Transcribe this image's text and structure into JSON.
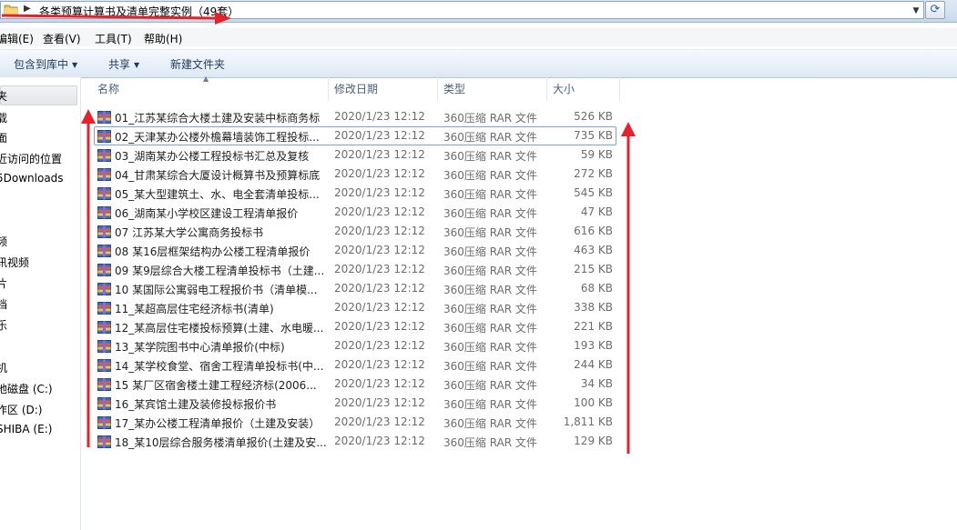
{
  "address": {
    "path": "各类预算计算书及清单完整实例（49套）"
  },
  "menu": [
    "编辑(E)",
    "查看(V)",
    "工具(T)",
    "帮助(H)"
  ],
  "toolbar": {
    "include_library": "包含到库中",
    "share": "共享",
    "new_folder": "新建文件夹"
  },
  "nav": [
    "夹",
    "载",
    "面",
    "近访问的位置",
    "5Downloads",
    "频",
    "讯视频",
    "片",
    "档",
    "乐",
    "机",
    "地磁盘 (C:)",
    "作区 (D:)",
    "SHIBA (E:)"
  ],
  "columns": {
    "name": "名称",
    "date": "修改日期",
    "type": "类型",
    "size": "大小"
  },
  "files": [
    {
      "name": "01_江苏某综合大楼土建及安装中标商务标",
      "date": "2020/1/23 12:12",
      "type": "360压缩 RAR 文件",
      "size": "526 KB"
    },
    {
      "name": "02_天津某办公楼外檐幕墙装饰工程投标...",
      "date": "2020/1/23 12:12",
      "type": "360压缩 RAR 文件",
      "size": "735 KB"
    },
    {
      "name": "03_湖南某办公楼工程投标书汇总及复核",
      "date": "2020/1/23 12:12",
      "type": "360压缩 RAR 文件",
      "size": "59 KB"
    },
    {
      "name": "04_甘肃某综合大厦设计概算书及预算标底",
      "date": "2020/1/23 12:12",
      "type": "360压缩 RAR 文件",
      "size": "272 KB"
    },
    {
      "name": "05_某大型建筑土、水、电全套清单投标...",
      "date": "2020/1/23 12:12",
      "type": "360压缩 RAR 文件",
      "size": "545 KB"
    },
    {
      "name": "06_湖南某小学校区建设工程清单报价",
      "date": "2020/1/23 12:12",
      "type": "360压缩 RAR 文件",
      "size": "47 KB"
    },
    {
      "name": "07 江苏某大学公寓商务投标书",
      "date": "2020/1/23 12:12",
      "type": "360压缩 RAR 文件",
      "size": "616 KB"
    },
    {
      "name": "08 某16层框架结构办公楼工程清单报价",
      "date": "2020/1/23 12:12",
      "type": "360压缩 RAR 文件",
      "size": "463 KB"
    },
    {
      "name": "09 某9层综合大楼工程清单投标书（土建...",
      "date": "2020/1/23 12:12",
      "type": "360压缩 RAR 文件",
      "size": "215 KB"
    },
    {
      "name": "10 某国际公寓弱电工程报价书（清单模...",
      "date": "2020/1/23 12:12",
      "type": "360压缩 RAR 文件",
      "size": "68 KB"
    },
    {
      "name": "11_某超高层住宅经济标书(清单)",
      "date": "2020/1/23 12:12",
      "type": "360压缩 RAR 文件",
      "size": "338 KB"
    },
    {
      "name": "12_某高层住宅楼投标预算(土建、水电暖...",
      "date": "2020/1/23 12:12",
      "type": "360压缩 RAR 文件",
      "size": "221 KB"
    },
    {
      "name": "13_某学院图书中心清单报价(中标)",
      "date": "2020/1/23 12:12",
      "type": "360压缩 RAR 文件",
      "size": "193 KB"
    },
    {
      "name": "14_某学校食堂、宿舍工程清单投标书(中...",
      "date": "2020/1/23 12:12",
      "type": "360压缩 RAR 文件",
      "size": "244 KB"
    },
    {
      "name": "15 某厂区宿舍楼土建工程经济标(2006...",
      "date": "2020/1/23 12:12",
      "type": "360压缩 RAR 文件",
      "size": "34 KB"
    },
    {
      "name": "16_某宾馆土建及装修投标报价书",
      "date": "2020/1/23 12:12",
      "type": "360压缩 RAR 文件",
      "size": "100 KB"
    },
    {
      "name": "17_某办公楼工程清单报价（土建及安装）",
      "date": "2020/1/23 12:12",
      "type": "360压缩 RAR 文件",
      "size": "1,811 KB"
    },
    {
      "name": "18_某10层综合服务楼清单报价(土建及安...",
      "date": "2020/1/23 12:12",
      "type": "360压缩 RAR 文件",
      "size": "129 KB"
    }
  ],
  "colors": {
    "annotation": "#e8202a",
    "selection_border": "#7da2ce"
  }
}
